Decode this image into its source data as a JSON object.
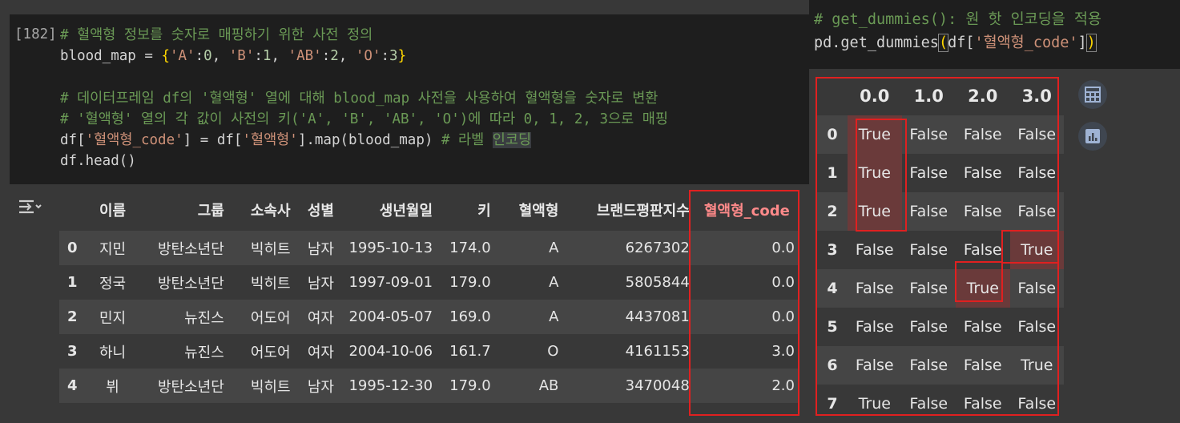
{
  "left_cell": {
    "exec_count": "[182]",
    "lines": [
      {
        "comment": "# 혈액형 정보를 숫자로 매핑하기 위한 사전 정의"
      },
      {
        "pre": "blood_map = ",
        "brace_open": "{",
        "k1": "'A'",
        "c1": ":",
        "v1": "0",
        "sep1": ", ",
        "k2": "'B'",
        "c2": ":",
        "v2": "1",
        "sep2": ", ",
        "k3": "'AB'",
        "c3": ":",
        "v3": "2",
        "sep3": ", ",
        "k4": "'O'",
        "c4": ":",
        "v4": "3",
        "brace_close": "}"
      },
      {
        "comment": "# 데이터프레임 df의 '혈액형' 열에 대해 blood_map 사전을 사용하여 혈액형을 숫자로 변환"
      },
      {
        "comment": "# '혈액형' 열의 각 값이 사전의 키('A', 'B', 'AB', 'O')에 따라 0, 1, 2, 3으로 매핑"
      },
      {
        "p1": "df[",
        "s1": "'혈액형_code'",
        "p2": "] = df[",
        "s2": "'혈액형'",
        "p3": "].map(blood_map) ",
        "cm": "# 라벨 ",
        "cm2": "인코딩"
      },
      {
        "code": "df.head()"
      }
    ]
  },
  "df": {
    "columns": [
      "",
      "이름",
      "그룹",
      "소속사",
      "성별",
      "생년월일",
      "키",
      "혈액형",
      "브랜드평판지수",
      "혈액형_code"
    ],
    "rows": [
      [
        "0",
        "지민",
        "방탄소년단",
        "빅히트",
        "남자",
        "1995-10-13",
        "174.0",
        "A",
        "6267302",
        "0.0"
      ],
      [
        "1",
        "정국",
        "방탄소년단",
        "빅히트",
        "남자",
        "1997-09-01",
        "179.0",
        "A",
        "5805844",
        "0.0"
      ],
      [
        "2",
        "민지",
        "뉴진스",
        "어도어",
        "여자",
        "2004-05-07",
        "169.0",
        "A",
        "4437081",
        "0.0"
      ],
      [
        "3",
        "하니",
        "뉴진스",
        "어도어",
        "여자",
        "2004-10-06",
        "161.7",
        "O",
        "4161153",
        "3.0"
      ],
      [
        "4",
        "뷔",
        "방탄소년단",
        "빅히트",
        "남자",
        "1995-12-30",
        "179.0",
        "AB",
        "3470048",
        "2.0"
      ]
    ]
  },
  "right_cell": {
    "comment": "# get_dummies(): 원 핫 인코딩을 적용",
    "code_pre": "pd.get_dummies",
    "paren_open": "(",
    "code_mid": "df[",
    "code_str": "'혈액형_code'",
    "code_end": "]",
    "paren_close": ")"
  },
  "dummies": {
    "columns": [
      "",
      "0.0",
      "1.0",
      "2.0",
      "3.0"
    ],
    "rows": [
      [
        "0",
        "True",
        "False",
        "False",
        "False"
      ],
      [
        "1",
        "True",
        "False",
        "False",
        "False"
      ],
      [
        "2",
        "True",
        "False",
        "False",
        "False"
      ],
      [
        "3",
        "False",
        "False",
        "False",
        "True"
      ],
      [
        "4",
        "False",
        "False",
        "True",
        "False"
      ],
      [
        "5",
        "False",
        "False",
        "False",
        "False"
      ],
      [
        "6",
        "False",
        "False",
        "False",
        "True"
      ],
      [
        "7",
        "True",
        "False",
        "False",
        "False"
      ]
    ]
  },
  "colors": {
    "highlight_box": "#e02020",
    "comment": "#6a9955",
    "string": "#ce9178"
  },
  "icons": {
    "output": "output-toggle-icon",
    "table": "table-icon",
    "chart": "chart-icon"
  }
}
